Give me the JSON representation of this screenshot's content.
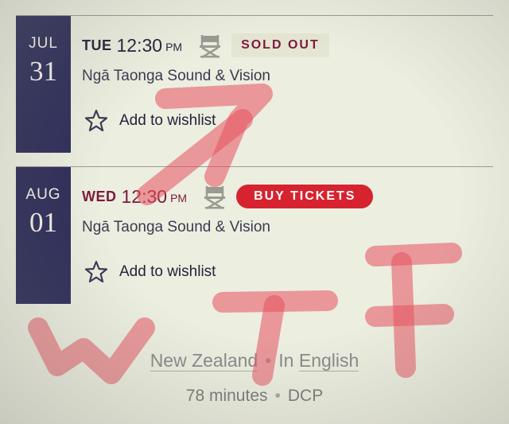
{
  "sessions": [
    {
      "month": "JUL",
      "day": "31",
      "weekday": "TUE",
      "time": "12:30",
      "ampm": "PM",
      "status": "SOLD OUT",
      "venue": "Ngā Taonga Sound & Vision",
      "wishlist_label": "Add to wishlist"
    },
    {
      "month": "AUG",
      "day": "01",
      "weekday": "WED",
      "time": "12:30",
      "ampm": "PM",
      "action": "BUY TICKETS",
      "venue": "Ngā Taonga Sound & Vision",
      "wishlist_label": "Add to wishlist"
    }
  ],
  "film_info": {
    "country": "New Zealand",
    "language_prefix": "In",
    "language": "English",
    "runtime": "78 minutes",
    "format": "DCP",
    "separator": "•"
  },
  "colors": {
    "date_block": "#2e2e5a",
    "buy_button": "#d6232f",
    "accent_maroon": "#7b1a3a",
    "scribble": "#e8505f"
  },
  "icons": [
    "directors-chair-icon",
    "star-outline-icon"
  ]
}
